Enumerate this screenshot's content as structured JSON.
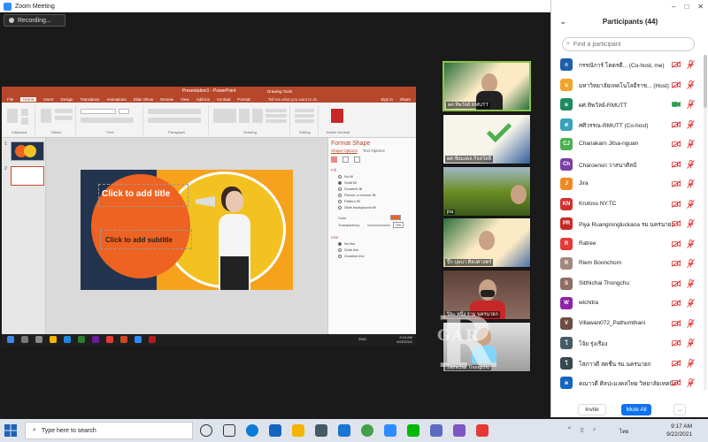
{
  "window": {
    "title": "Zoom Meeting"
  },
  "recording": {
    "label": "Recording..."
  },
  "ppt": {
    "title": "Presentation1 - PowerPoint",
    "drawing_tools": "Drawing Tools",
    "tell_me": "Tell me what you want to do",
    "sign_in": "Sign in",
    "share": "Share",
    "tabs": [
      "File",
      "Home",
      "Insert",
      "Design",
      "Transitions",
      "Animations",
      "Slide Show",
      "Review",
      "View",
      "Add-ins",
      "Acrobat",
      "Format"
    ],
    "ribbon_groups": [
      "Clipboard",
      "Slides",
      "Font",
      "Paragraph",
      "Drawing",
      "Editing",
      "Adobe Acrobat"
    ],
    "slide_title": "Click to add title",
    "slide_subtitle": "Click to add subtitle",
    "format_pane": {
      "title": "Format Shape",
      "tab1": "Shape Options",
      "tab2": "Text Options",
      "fill_header": "Fill",
      "fill_options": [
        "No fill",
        "Solid fill",
        "Gradient fill",
        "Picture or texture fill",
        "Pattern fill",
        "Slide background fill"
      ],
      "color_label": "Color",
      "transparency_label": "Transparency",
      "transparency_value": "0%",
      "line_header": "Line",
      "line_options": [
        "No line",
        "Solid line",
        "Gradient line"
      ]
    },
    "status": {
      "slide": "Slide 2 of 2",
      "lang": "English (United States)",
      "notes": "Notes",
      "comments": "Comments",
      "zoom": "52%"
    },
    "inner_clock": {
      "time": "9:16 AM",
      "date": "9/22/2021"
    },
    "inner_lang": "ENG"
  },
  "videos": [
    {
      "name": "ผศ.ทิพวัลย์ RMUTT",
      "color": "#2a6f3a"
    },
    {
      "name": "ผศ.ชัยมงคล กิจสวัสดิ์",
      "color": "#2f5c9a"
    },
    {
      "name": "jira",
      "color": "#556b2f"
    },
    {
      "name": "ปี๊ก บุษบา ศิลปศาสตร์",
      "color": "#4a6fa5"
    },
    {
      "name": "ปิยะ หนึ่ง ราม นครนายก",
      "color": "#6b4a3a"
    },
    {
      "name": "Sitthichai Thongchu",
      "color": "#8a8a8a"
    }
  ],
  "watermark": {
    "big": "R",
    "small": "GAR"
  },
  "participants_panel": {
    "title": "Participants (44)",
    "search_placeholder": "Find a participant",
    "invite": "Invite",
    "mute_all": "Mute All",
    "more": "...",
    "list": [
      {
        "initial": "ก",
        "name": "กรรณิการ์ โคตรดี... (Co-host, me)",
        "color": "#1f5fa8",
        "video_on": false
      },
      {
        "initial": "ม",
        "name": "มหาวิทยาลัยเทคโนโลยีราช... (Host)",
        "color": "#f3a32b",
        "video_on": false
      },
      {
        "initial": "ผ",
        "name": "ผศ.ทิพวัลย์-RMUTT",
        "color": "#1f8a5f",
        "video_on": true
      },
      {
        "initial": "ศ",
        "name": "ศศิวรรณ-RMUTT (Co-host)",
        "color": "#3aa2b8",
        "video_on": false
      },
      {
        "initial": "CJ",
        "name": "Chanakarn Jitsa-nguan",
        "color": "#4caf50",
        "video_on": false
      },
      {
        "initial": "Ch",
        "name": "Charoensri วาสนาศิลป์",
        "color": "#7b3fa8",
        "video_on": false
      },
      {
        "initial": "J",
        "name": "Jira",
        "color": "#f08a24",
        "video_on": false
      },
      {
        "initial": "KN",
        "name": "Krutoss NY.TC",
        "color": "#d32f2f",
        "video_on": false
      },
      {
        "initial": "PR",
        "name": "Piya Ruangrongluckana รม.นครนายก",
        "color": "#c62828",
        "video_on": false
      },
      {
        "initial": "R",
        "name": "Ratree",
        "color": "#e53935",
        "video_on": false
      },
      {
        "initial": "R",
        "name": "Riem Boonchom",
        "color": "#a1887f",
        "video_on": false
      },
      {
        "initial": "S",
        "name": "Sitthichai Thongchu",
        "color": "#8d6e63",
        "video_on": false
      },
      {
        "initial": "W",
        "name": "wichitra",
        "color": "#8e24aa",
        "video_on": false
      },
      {
        "initial": "V",
        "name": "Villawan072_Pathumthani",
        "color": "#6d4c41",
        "video_on": false
      },
      {
        "initial": "โ",
        "name": "โจ้ย รุ่งเรือง",
        "color": "#455a64",
        "video_on": false
      },
      {
        "initial": "โ",
        "name": "โสภาวดี สดชื่น รม.นครนายก",
        "color": "#37474f",
        "video_on": false
      },
      {
        "initial": "ค",
        "name": "คณาวดี ศิลปะมงคลไทย วิทยาลัยเทคนิค...",
        "color": "#1565c0",
        "video_on": false
      }
    ]
  },
  "taskbar": {
    "search_placeholder": "Type here to search",
    "lang": "ไทย",
    "time": "9:17 AM",
    "date": "9/22/2021"
  }
}
